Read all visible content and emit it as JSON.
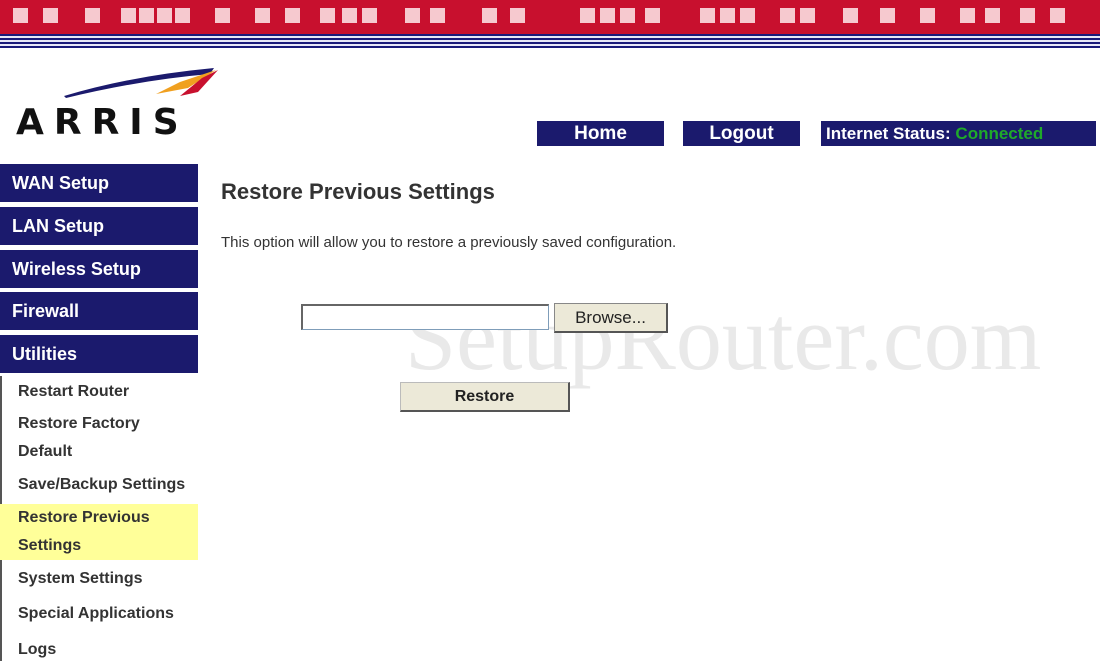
{
  "brand": {
    "logo_text": "ARRIS"
  },
  "header": {
    "home_label": "Home",
    "logout_label": "Logout",
    "status_label": "Internet Status:",
    "status_value": "Connected",
    "status_color": "#1faa2a",
    "bar_color": "#1b1a6d"
  },
  "sidebar": {
    "sections": [
      {
        "label": "WAN Setup"
      },
      {
        "label": "LAN Setup"
      },
      {
        "label": "Wireless Setup"
      },
      {
        "label": "Firewall"
      },
      {
        "label": "Utilities"
      }
    ],
    "sub_items": [
      {
        "line1": "Restart Router",
        "line2": ""
      },
      {
        "line1": "Restore Factory",
        "line2": "Default"
      },
      {
        "line1": "Save/Backup Settings",
        "line2": ""
      },
      {
        "line1": "Restore Previous",
        "line2": "Settings",
        "active": true
      },
      {
        "line1": "System Settings",
        "line2": ""
      },
      {
        "line1": "Special Applications",
        "line2": ""
      },
      {
        "line1": "Logs",
        "line2": ""
      }
    ],
    "active_highlight_color": "#ffff99"
  },
  "main": {
    "title": "Restore Previous Settings",
    "description": "This option will allow you to restore a previously saved configuration.",
    "file_input_value": "",
    "browse_label": "Browse...",
    "restore_label": "Restore"
  },
  "watermark": "SetupRouter.com"
}
